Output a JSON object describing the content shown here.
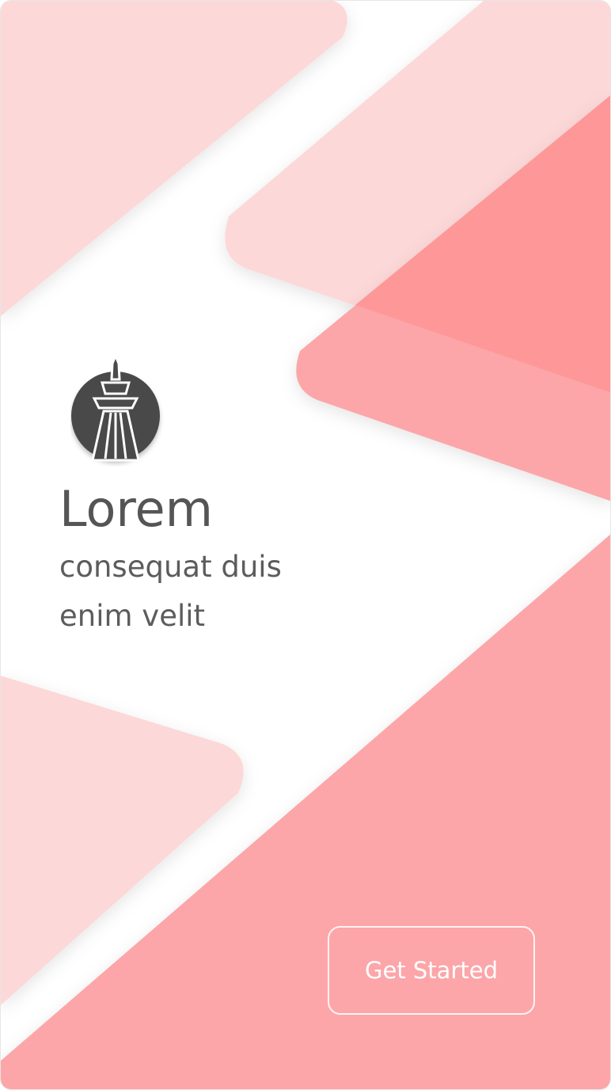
{
  "welcome": {
    "title": "Lorem",
    "subtitle": "consequat duis enim velit",
    "logo_icon": "tower-icon",
    "cta_label": "Get Started"
  },
  "colors": {
    "background": "#ffffff",
    "shape_light": "#fdd8d8",
    "shape_mid": "#fca6a9",
    "shape_dark": "#fe9797",
    "text": "#555555",
    "logo": "#4a4a4a",
    "button_text": "#ffffff"
  }
}
